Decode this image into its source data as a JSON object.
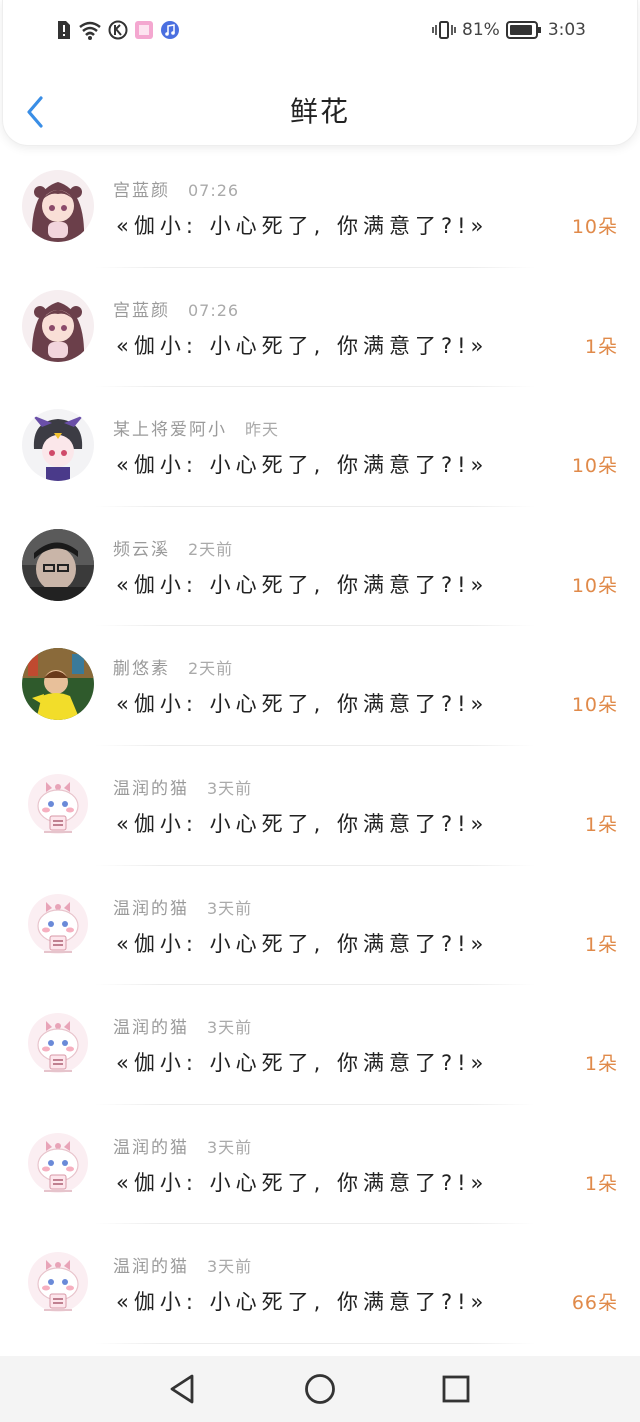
{
  "status_bar": {
    "battery_text": "81%",
    "time": "3:03",
    "left_icons": [
      "alert-icon",
      "wifi-icon",
      "k-app-icon",
      "pink-app-icon",
      "music-app-icon"
    ],
    "right_icons": [
      "vibrate-icon",
      "battery-icon"
    ]
  },
  "header": {
    "title": "鲜花",
    "back_icon": "chevron-left-icon",
    "accent_color": "#3a8ee6"
  },
  "colors": {
    "count": "#e08a4a",
    "username": "#9a9a9a",
    "message": "#222222"
  },
  "items": [
    {
      "user": "宫蓝颜",
      "time": "07:26",
      "message": "«伽小: 小心死了, 你满意了?!»",
      "count": "10朵",
      "avatar": "anime-girl-avatar"
    },
    {
      "user": "宫蓝颜",
      "time": "07:26",
      "message": "«伽小: 小心死了, 你满意了?!»",
      "count": "1朵",
      "avatar": "anime-girl-avatar"
    },
    {
      "user": "某上将爱阿小",
      "time": "昨天",
      "message": "«伽小: 小心死了, 你满意了?!»",
      "count": "10朵",
      "avatar": "chibi-character-avatar"
    },
    {
      "user": "频云溪",
      "time": "2天前",
      "message": "«伽小: 小心死了, 你满意了?!»",
      "count": "10朵",
      "avatar": "photo-person-avatar"
    },
    {
      "user": "蒯悠素",
      "time": "2天前",
      "message": "«伽小: 小心死了, 你满意了?!»",
      "count": "10朵",
      "avatar": "photo-child-avatar"
    },
    {
      "user": "温润的猫",
      "time": "3天前",
      "message": "«伽小: 小心死了, 你满意了?!»",
      "count": "1朵",
      "avatar": "cute-cat-avatar"
    },
    {
      "user": "温润的猫",
      "time": "3天前",
      "message": "«伽小: 小心死了, 你满意了?!»",
      "count": "1朵",
      "avatar": "cute-cat-avatar"
    },
    {
      "user": "温润的猫",
      "time": "3天前",
      "message": "«伽小: 小心死了, 你满意了?!»",
      "count": "1朵",
      "avatar": "cute-cat-avatar"
    },
    {
      "user": "温润的猫",
      "time": "3天前",
      "message": "«伽小: 小心死了, 你满意了?!»",
      "count": "1朵",
      "avatar": "cute-cat-avatar"
    },
    {
      "user": "温润的猫",
      "time": "3天前",
      "message": "«伽小: 小心死了, 你满意了?!»",
      "count": "66朵",
      "avatar": "cute-cat-avatar"
    }
  ],
  "nav_bar": {
    "buttons": [
      "back-triangle-icon",
      "home-circle-icon",
      "recent-square-icon"
    ]
  }
}
